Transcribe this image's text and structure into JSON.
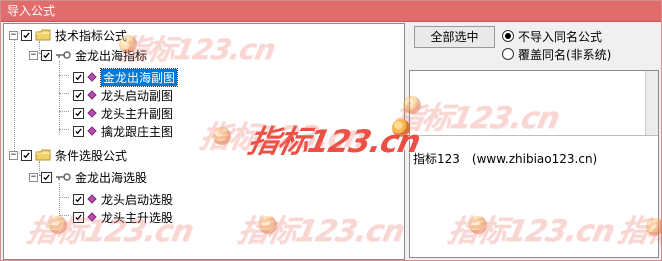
{
  "window": {
    "title": "导入公式",
    "title_color": "#ffffff",
    "titlebar_color": "#e06c6c"
  },
  "tree": {
    "groups": [
      {
        "label": "技术指标公式",
        "expander": "−",
        "children": [
          {
            "label": "金龙出海指标",
            "expander": "−",
            "items": [
              {
                "label": "金龙出海副图",
                "selected": true
              },
              {
                "label": "龙头启动副图",
                "selected": false
              },
              {
                "label": "龙头主升副图",
                "selected": false
              },
              {
                "label": "擒龙跟庄主图",
                "selected": false
              }
            ]
          }
        ]
      },
      {
        "label": "条件选股公式",
        "expander": "−",
        "children": [
          {
            "label": "金龙出海选股",
            "expander": "−",
            "items": [
              {
                "label": "龙头启动选股",
                "selected": false
              },
              {
                "label": "龙头主升选股",
                "selected": false
              }
            ]
          }
        ]
      }
    ]
  },
  "actions": {
    "select_all_label": "全部选中"
  },
  "import_options": {
    "selected": "不导入同名公式",
    "options": [
      "不导入同名公式",
      "覆盖同名(非系统)"
    ]
  },
  "description": {
    "text": "指标123　(www.zhibiao123.cn)"
  },
  "watermarks": [
    {
      "text": "指标123.cn"
    },
    {
      "text": "指标123.cn"
    },
    {
      "text": "指标123.cn"
    },
    {
      "text": "指标123.cn"
    },
    {
      "text": "指标123.cn"
    },
    {
      "text": "指标123.cn"
    },
    {
      "text": "指标123.cn"
    },
    {
      "text": "指标123.cn"
    }
  ],
  "colors": {
    "selection_bg": "#0078d7",
    "watermark": "#ea3d32",
    "folder": "#f2d36b"
  }
}
